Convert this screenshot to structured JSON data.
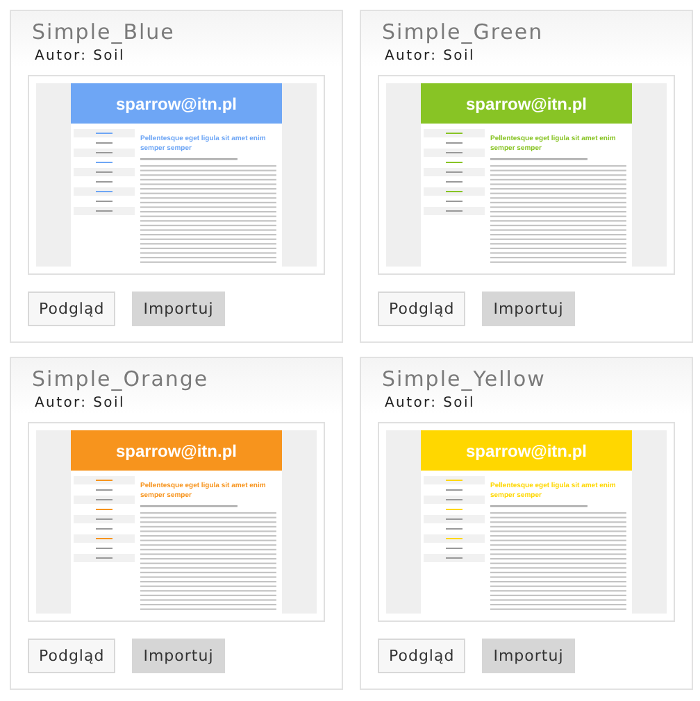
{
  "themes": [
    {
      "name": "Simple_Blue",
      "author": "Autor: Soil",
      "color": "#6ea6f5",
      "preview": {
        "header": "sparrow@itn.pl",
        "title": "Pellentesque eget ligula sit amet enim semper semper"
      },
      "buttons": [
        "Podgląd",
        "Importuj"
      ]
    },
    {
      "name": "Simple_Green",
      "author": "Autor: Soil",
      "color": "#88c425",
      "preview": {
        "header": "sparrow@itn.pl",
        "title": "Pellentesque eget ligula sit amet enim semper semper"
      },
      "buttons": [
        "Podgląd",
        "Importuj"
      ]
    },
    {
      "name": "Simple_Orange",
      "author": "Autor: Soil",
      "color": "#f7941d",
      "preview": {
        "header": "sparrow@itn.pl",
        "title": "Pellentesque eget ligula sit amet enim semper semper"
      },
      "buttons": [
        "Podgląd",
        "Importuj"
      ]
    },
    {
      "name": "Simple_Yellow",
      "author": "Autor: Soil",
      "color": "#ffd700",
      "preview": {
        "header": "sparrow@itn.pl",
        "title": "Pellentesque eget ligula sit amet enim semper semper"
      },
      "buttons": [
        "Podgląd",
        "Importuj"
      ]
    }
  ]
}
